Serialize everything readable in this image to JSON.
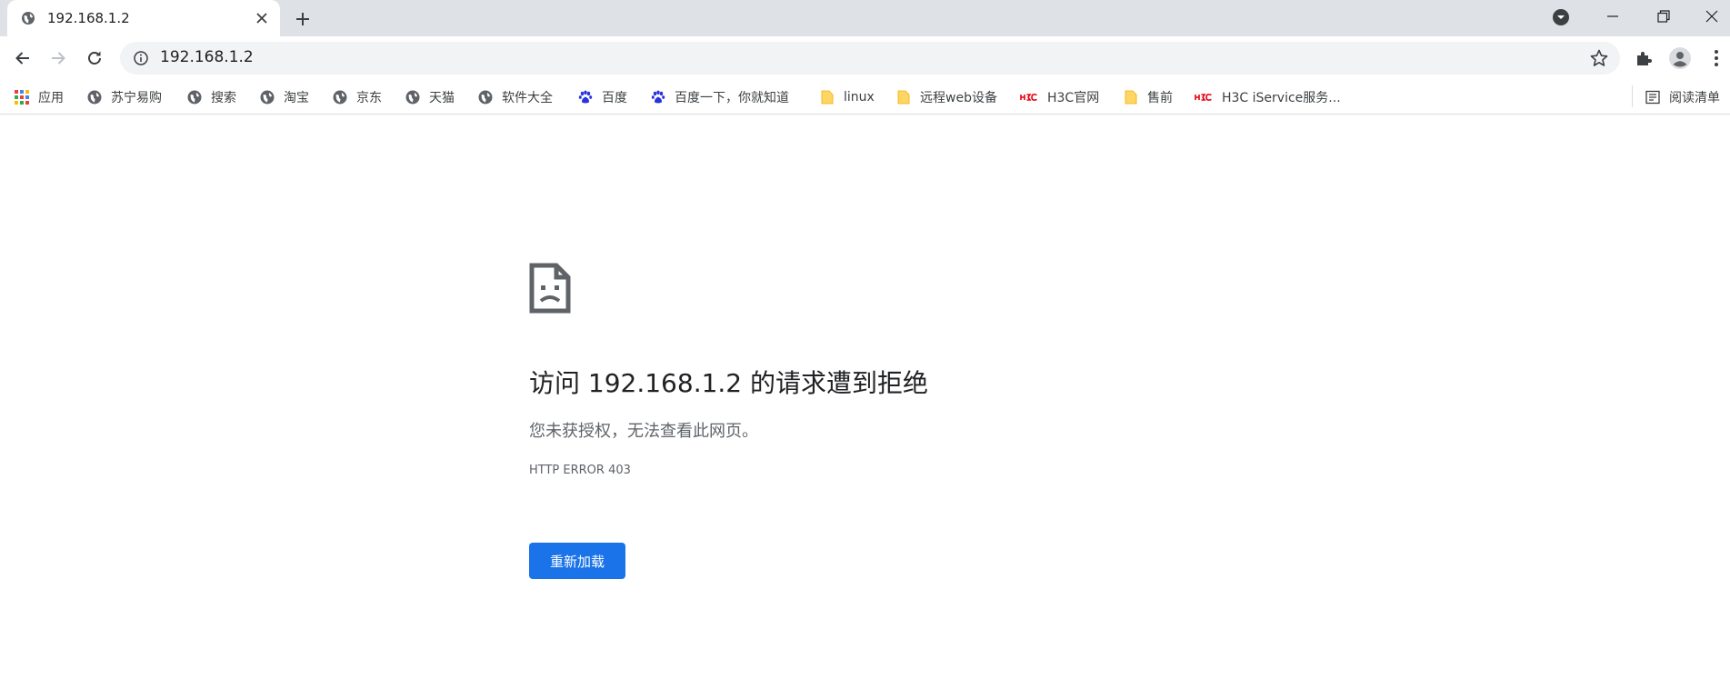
{
  "colors": {
    "tabstrip": "#dee1e6",
    "omnibox": "#f1f3f4",
    "accent": "#1a73e8",
    "h3c_red": "#e60012",
    "folder": "#fdd663"
  },
  "tab": {
    "title": "192.168.1.2",
    "favicon": "globe-icon"
  },
  "omnibox": {
    "url": "192.168.1.2"
  },
  "bookmarks": [
    {
      "label": "应用",
      "icon": "apps-grid-icon"
    },
    {
      "label": "苏宁易购",
      "icon": "globe-icon"
    },
    {
      "label": "搜索",
      "icon": "globe-icon"
    },
    {
      "label": "淘宝",
      "icon": "globe-icon"
    },
    {
      "label": "京东",
      "icon": "globe-icon"
    },
    {
      "label": "天猫",
      "icon": "globe-icon"
    },
    {
      "label": "软件大全",
      "icon": "globe-icon"
    },
    {
      "label": "百度",
      "icon": "baidu-paw-icon"
    },
    {
      "label": "百度一下，你就知道",
      "icon": "baidu-paw-icon"
    },
    {
      "label": "linux",
      "icon": "folder-icon"
    },
    {
      "label": "远程web设备",
      "icon": "folder-icon"
    },
    {
      "label": "H3C官网",
      "icon": "h3c-logo-icon"
    },
    {
      "label": "售前",
      "icon": "folder-icon"
    },
    {
      "label": "H3C iService服务...",
      "icon": "h3c-logo-icon"
    }
  ],
  "reading_list": {
    "label": "阅读清单",
    "icon": "reading-list-icon"
  },
  "error": {
    "title": "访问 192.168.1.2 的请求遭到拒绝",
    "description": "您未获授权，无法查看此网页。",
    "code": "HTTP ERROR 403",
    "reload_label": "重新加载",
    "icon": "sad-page-icon"
  }
}
